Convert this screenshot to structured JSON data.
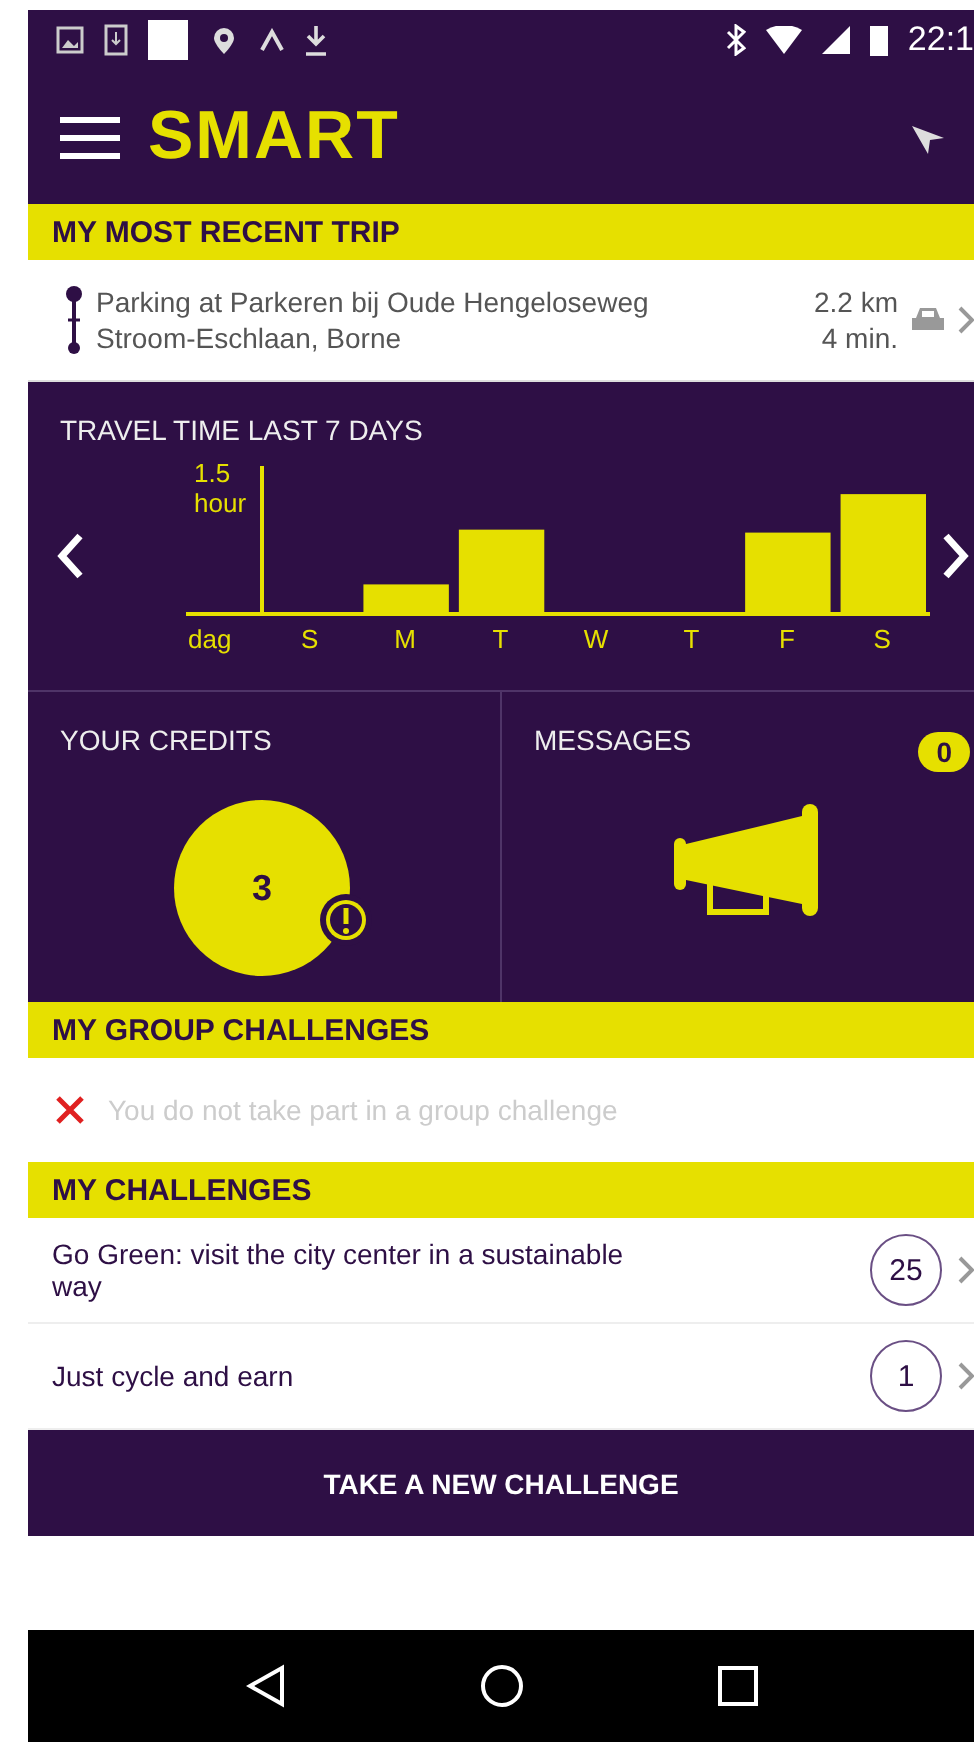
{
  "status_bar": {
    "time": "22:1"
  },
  "app_bar": {
    "logo": "SMART"
  },
  "recent_trip": {
    "header": "MY MOST RECENT TRIP",
    "from": "Parking at Parkeren bij Oude Hengeloseweg",
    "to": "Stroom-Eschlaan, Borne",
    "distance": "2.2 km",
    "duration": "4 min."
  },
  "travel_time": {
    "title": "TRAVEL TIME LAST 7 DAYS",
    "y_max_label": "1.5",
    "y_unit": "hour",
    "x_label": "dag",
    "days": [
      "S",
      "M",
      "T",
      "W",
      "T",
      "F",
      "S"
    ]
  },
  "credits": {
    "title": "YOUR CREDITS",
    "value": "3"
  },
  "messages": {
    "title": "MESSAGES",
    "count": "0"
  },
  "group_challenges": {
    "header": "MY GROUP CHALLENGES",
    "empty_text": "You do not take part in a group challenge"
  },
  "challenges": {
    "header": "MY CHALLENGES",
    "items": [
      {
        "title": "Go Green: visit the city center in a sustainable way",
        "points": "25"
      },
      {
        "title": "Just cycle and earn",
        "points": "1"
      }
    ]
  },
  "new_challenge_button": "TAKE A NEW CHALLENGE"
}
